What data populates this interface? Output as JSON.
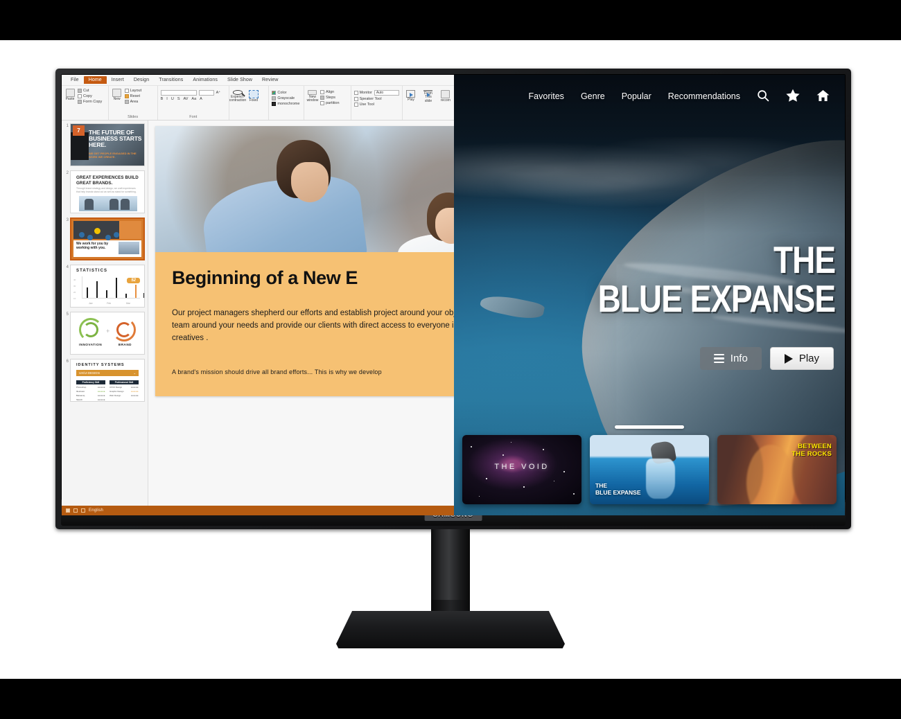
{
  "scene": {
    "device_brand": "SAMSUNG",
    "description": "Samsung monitor displaying a split screen with a presentation app on the left and a smart TV streaming interface on the right"
  },
  "presentation": {
    "tabs": [
      "File",
      "Home",
      "Insert",
      "Design",
      "Transitions",
      "Animations",
      "Slide Show",
      "Review"
    ],
    "active_tab": "Home",
    "ribbon": {
      "groups": [
        {
          "label": "",
          "items": [
            "Paste",
            "Cut",
            "Copy",
            "Form Copy"
          ]
        },
        {
          "label": "Slides",
          "items": [
            "New",
            "Layout",
            "Reset",
            "Area"
          ]
        },
        {
          "label": "Font",
          "items": []
        },
        {
          "label": "",
          "items": [
            "Expend / contraction",
            "Fixed"
          ]
        },
        {
          "label": "",
          "items": [
            "Color",
            "Grayscale",
            "monochrome"
          ]
        },
        {
          "label": "",
          "items": [
            "New window",
            "Align",
            "Steps",
            "partition"
          ]
        },
        {
          "label": "",
          "items": [
            "Monitor",
            "Speaker Tool",
            "Use Tool"
          ],
          "select_value": "Auto"
        },
        {
          "label": "",
          "items": [
            "Play",
            "From This slide",
            "recorn"
          ]
        }
      ],
      "labels": {
        "paste": "Paste",
        "cut": "Cut",
        "copy": "Copy",
        "form_copy": "Form Copy",
        "new": "New",
        "layout": "Layout",
        "reset": "Reset",
        "area": "Area",
        "slides_group": "Slides",
        "font_group": "Font",
        "expand": "Expend / contraction",
        "fixed": "Fixed",
        "color": "Color",
        "grayscale": "Grayscale",
        "monochrome": "monochrome",
        "new_window": "New window",
        "align": "Align",
        "steps": "Steps",
        "partition": "partition",
        "monitor": "Monitor",
        "monitor_value": "Auto",
        "speaker_tool": "Speaker Tool",
        "use_tool": "Use Tool",
        "play": "Play",
        "from_this_slide": "From This slide",
        "record": "recorn"
      }
    },
    "thumbnails": [
      {
        "number": "1",
        "title": "THE FUTURE OF BUSINESS STARTS HERE.",
        "subtitle": "WE GET PEOPLE ENGAGED IN THE WORK WE CREATE.",
        "badge": "7",
        "selected": false
      },
      {
        "number": "2",
        "title": "GREAT EXPERIENCES BUILD GREAT BRANDS.",
        "body": "Through brand strategy and design, we craft experiences that help brands stand out as well as stand for something.",
        "selected": false
      },
      {
        "number": "3",
        "title": "We work for you by working with you.",
        "selected": true
      },
      {
        "number": "4",
        "title": "STATISTICS",
        "callout": "52",
        "selected": false
      },
      {
        "number": "5",
        "label_left": "INNOVATION",
        "label_right": "BRAND",
        "plus": "+",
        "selected": false
      },
      {
        "number": "6",
        "title": "IDENTITY SYSTEMS",
        "dropdown": "UX/UI DESIGN",
        "col_left_header": "Proficiency Skill",
        "col_right_header": "Professional Skill",
        "left_rows": [
          "Photoshop",
          "Illustrator",
          "Balsamiq",
          "Sketch"
        ],
        "right_rows": [
          "UX/UI Design",
          "Graphic Design",
          "Web Design"
        ],
        "selected": false
      }
    ],
    "chart_data": {
      "type": "bar",
      "title": "STATISTICS",
      "categories": [
        "Jan",
        "Feb",
        "Mar"
      ],
      "yticks": [
        "10",
        "20",
        "30",
        "40"
      ],
      "values": [
        22,
        34,
        16,
        42,
        8,
        27,
        10
      ],
      "highlight_value": 52,
      "highlight_label": "52",
      "xlabel": "",
      "ylabel": "",
      "ylim": [
        0,
        45
      ],
      "grid": false
    },
    "slide": {
      "title": "Beginning of a New E",
      "paragraph": "Our project managers shepherd our efforts and establish project around your objectives. We build a team around your needs and provide our clients with direct access to everyone involved... including the creatives .",
      "footnote": "A brand's mission should drive all brand efforts... This is why we develop"
    },
    "status_bar": {
      "language": "English"
    }
  },
  "tv": {
    "nav": [
      {
        "label": "Favorites"
      },
      {
        "label": "Genre"
      },
      {
        "label": "Popular"
      },
      {
        "label": "Recommendations"
      }
    ],
    "icons": {
      "search": "search-icon",
      "favorite": "star-icon",
      "home": "home-icon",
      "search_glyph": "⌕",
      "star_glyph": "★",
      "home_glyph": "⌂"
    },
    "hero": {
      "title_line1": "THE",
      "title_line2": "BLUE EXPANSE",
      "info_button": "Info",
      "play_button": "Play"
    },
    "rail": [
      {
        "title": "THE VOID",
        "kind": "space"
      },
      {
        "title_line1": "THE",
        "title_line2": "BLUE EXPANSE",
        "kind": "ocean"
      },
      {
        "title_line1": "BETWEEN",
        "title_line2": "THE ROCKS",
        "kind": "canyon"
      }
    ],
    "colors": {
      "accent_yellow": "#ffe600",
      "ocean_blue": "#2c86ac",
      "play_button_bg": "#f2f2f2"
    }
  }
}
